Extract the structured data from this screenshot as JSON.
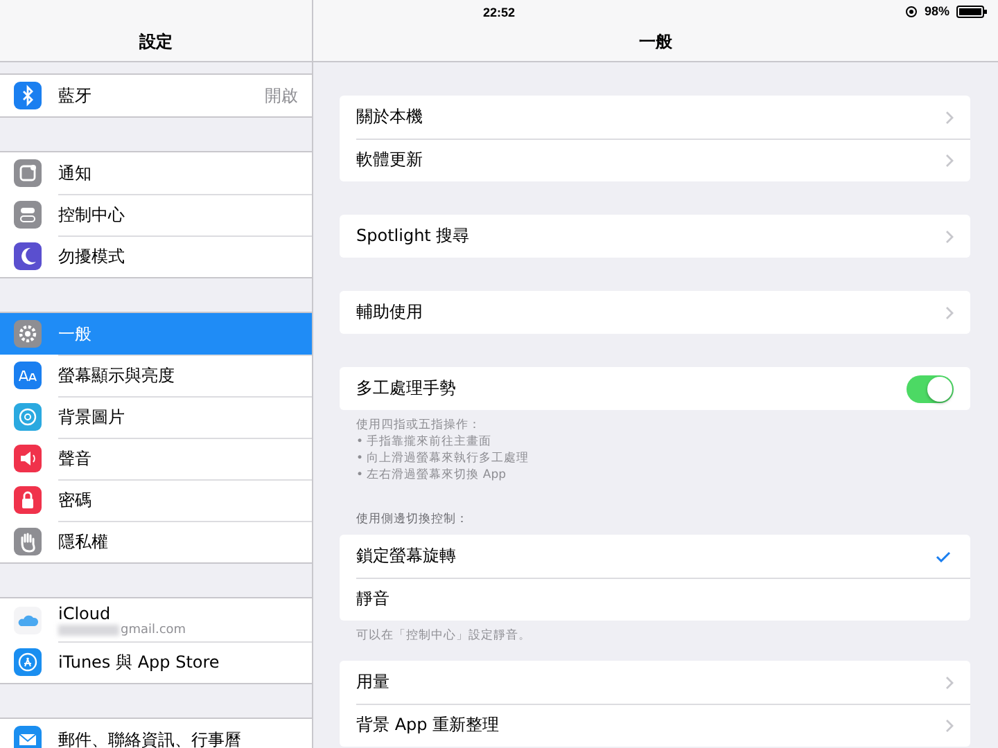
{
  "status_bar": {
    "time": "22:52",
    "battery": "98%"
  },
  "sidebar": {
    "title": "設定",
    "groups": [
      [
        {
          "label": "藍牙",
          "value": "開啟",
          "selected": false
        }
      ],
      [
        {
          "label": "通知",
          "selected": false
        },
        {
          "label": "控制中心",
          "selected": false
        },
        {
          "label": "勿擾模式",
          "selected": false
        }
      ],
      [
        {
          "label": "一般",
          "selected": true
        },
        {
          "label": "螢幕顯示與亮度",
          "selected": false
        },
        {
          "label": "背景圖片",
          "selected": false
        },
        {
          "label": "聲音",
          "selected": false
        },
        {
          "label": "密碼",
          "selected": false
        },
        {
          "label": "隱私權",
          "selected": false
        }
      ],
      [
        {
          "label": "iCloud",
          "subtitle": "gmail.com",
          "selected": false
        },
        {
          "label": "iTunes 與 App Store",
          "selected": false
        }
      ],
      [
        {
          "label": "郵件、聯絡資訊、行事曆",
          "selected": false
        }
      ]
    ]
  },
  "detail": {
    "title": "一般",
    "groups": [
      {
        "rows": [
          {
            "label": "關於本機",
            "kind": "link"
          },
          {
            "label": "軟體更新",
            "kind": "link"
          }
        ]
      },
      {
        "rows": [
          {
            "label": "Spotlight 搜尋",
            "kind": "link"
          }
        ]
      },
      {
        "rows": [
          {
            "label": "輔助使用",
            "kind": "link"
          }
        ]
      },
      {
        "rows": [
          {
            "label": "多工處理手勢",
            "kind": "toggle",
            "on": true
          }
        ],
        "footer": [
          "使用四指或五指操作：",
          "• 手指靠攏來前往主畫面",
          "• 向上滑過螢幕來執行多工處理",
          "• 左右滑過螢幕來切換 App"
        ]
      },
      {
        "header": "使用側邊切換控制：",
        "rows": [
          {
            "label": "鎖定螢幕旋轉",
            "kind": "check",
            "checked": true
          },
          {
            "label": "靜音",
            "kind": "check",
            "checked": false
          }
        ],
        "footer": [
          "可以在「控制中心」設定靜音。"
        ]
      },
      {
        "rows": [
          {
            "label": "用量",
            "kind": "link"
          },
          {
            "label": "背景 App 重新整理",
            "kind": "link"
          }
        ]
      }
    ]
  }
}
